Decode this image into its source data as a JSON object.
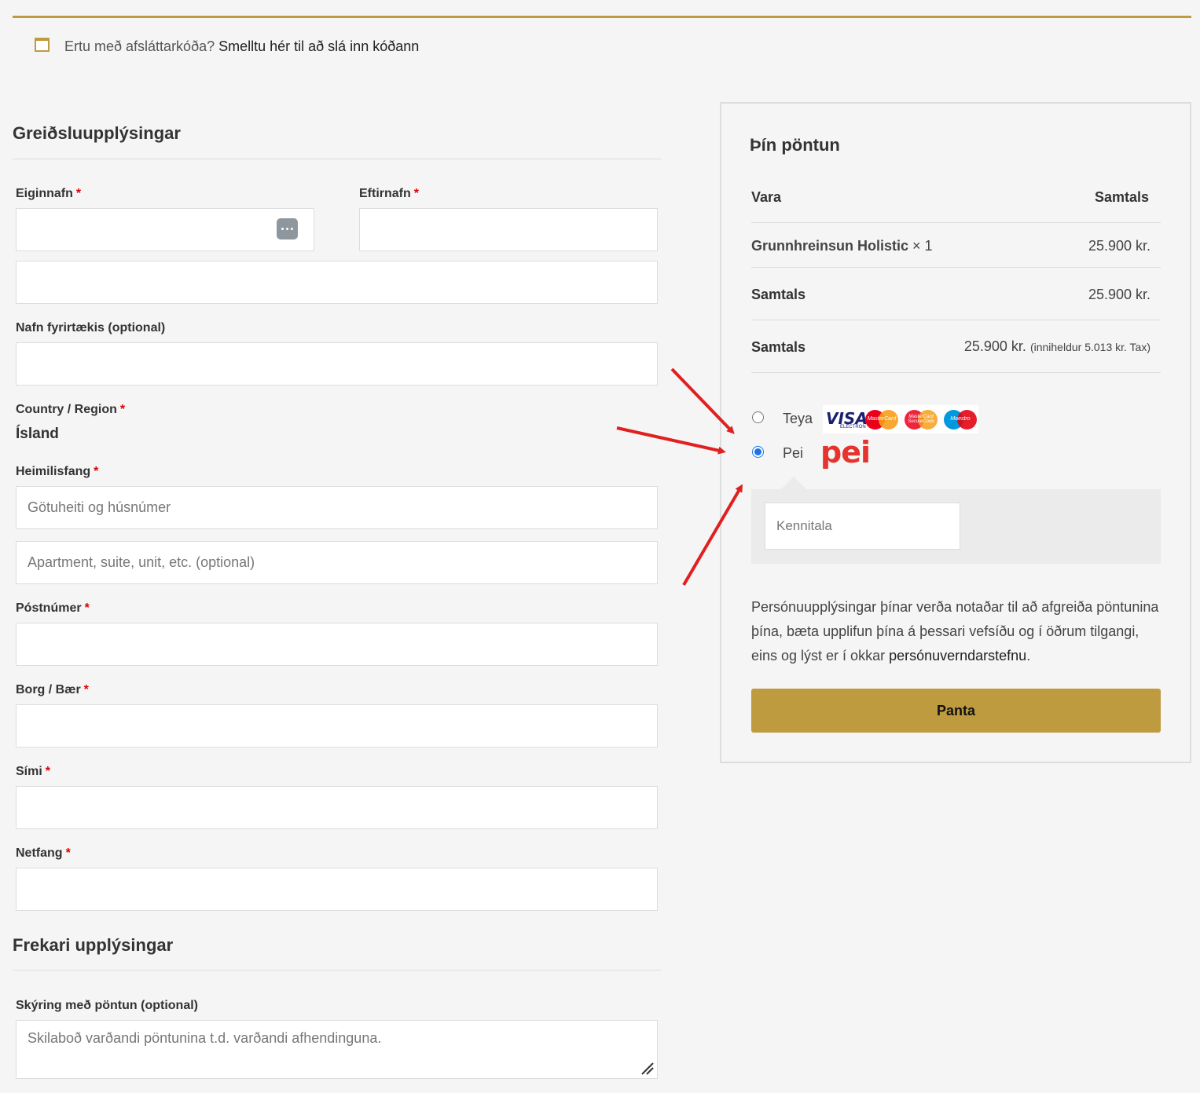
{
  "coupon": {
    "prompt": "Ertu með afsláttarkóða?",
    "link": "Smelltu hér til að slá inn kóðann"
  },
  "billing": {
    "title": "Greiðsluupplýsingar",
    "first_name_label": "Eiginnafn",
    "last_name_label": "Eftirnafn",
    "company_label": "Nafn fyrirtækis (optional)",
    "country_label": "Country / Region",
    "country_value": "Ísland",
    "address_label": "Heimilisfang",
    "address1_placeholder": "Götuheiti og húsnúmer",
    "address2_placeholder": "Apartment, suite, unit, etc. (optional)",
    "postcode_label": "Póstnúmer",
    "city_label": "Borg / Bær",
    "phone_label": "Sími",
    "email_label": "Netfang",
    "required_mark": "*"
  },
  "additional": {
    "title": "Frekari upplýsingar",
    "notes_label": "Skýring með pöntun (optional)",
    "notes_placeholder": "Skilaboð varðandi pöntunina t.d. varðandi afhendinguna."
  },
  "order": {
    "title": "Þín pöntun",
    "col_product": "Vara",
    "col_total": "Samtals",
    "item_name": "Grunnhreinsun Holistic",
    "item_qty": "× 1",
    "item_price": "25.900 kr.",
    "subtotal_label": "Samtals",
    "subtotal_value": "25.900 kr.",
    "total_label": "Samtals",
    "total_value": "25.900 kr.",
    "total_tax_note": "(inniheldur 5.013 kr. Tax)"
  },
  "payment": {
    "methods": [
      {
        "label": "Teya",
        "selected": false
      },
      {
        "label": "Pei",
        "selected": true
      }
    ],
    "card_logos": {
      "visa": "VISA",
      "visa_sub": "ELECTRON",
      "mastercard": "MasterCard",
      "securecode": "MasterCard SecureCode",
      "maestro": "Maestro"
    },
    "pei_logo": "pei",
    "kennitala_placeholder": "Kennitala"
  },
  "privacy": {
    "text": "Persónuupplýsingar þínar verða notaðar til að afgreiða pöntunina þína, bæta upplifun þína á þessari vefsíðu og í öðrum tilgangi, eins og lýst er í okkar ",
    "link": "persónuverndarstefnu",
    "end": "."
  },
  "place_order_label": "Panta",
  "colors": {
    "accent": "#bf9b3f",
    "required": "#dd0000",
    "radio": "#1a73e8",
    "annotation_arrow": "#e02020"
  }
}
